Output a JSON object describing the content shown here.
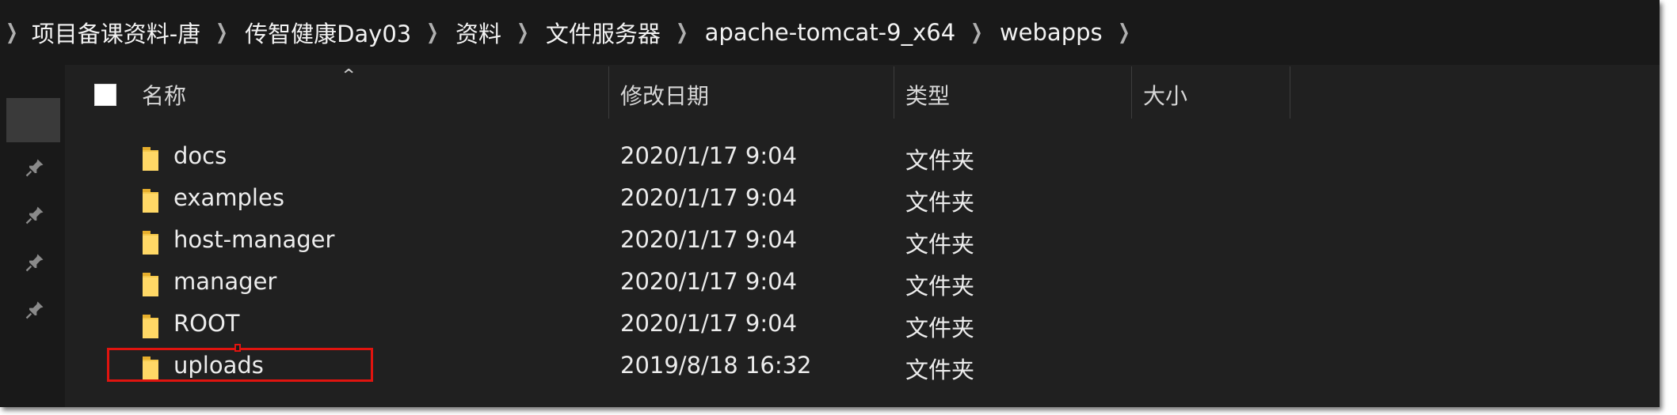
{
  "breadcrumb": {
    "items": [
      "项目备课资料-唐",
      "传智健康Day03",
      "资料",
      "文件服务器",
      "apache-tomcat-9_x64",
      "webapps"
    ]
  },
  "columns": {
    "name": "名称",
    "modified": "修改日期",
    "type": "类型",
    "size": "大小"
  },
  "rows": [
    {
      "name": "docs",
      "modified": "2020/1/17 9:04",
      "type": "文件夹",
      "size": ""
    },
    {
      "name": "examples",
      "modified": "2020/1/17 9:04",
      "type": "文件夹",
      "size": ""
    },
    {
      "name": "host-manager",
      "modified": "2020/1/17 9:04",
      "type": "文件夹",
      "size": ""
    },
    {
      "name": "manager",
      "modified": "2020/1/17 9:04",
      "type": "文件夹",
      "size": ""
    },
    {
      "name": "ROOT",
      "modified": "2020/1/17 9:04",
      "type": "文件夹",
      "size": ""
    },
    {
      "name": "uploads",
      "modified": "2019/8/18 16:32",
      "type": "文件夹",
      "size": ""
    }
  ],
  "icons": {
    "folder": "folder-icon",
    "pin": "pin-icon",
    "chevron": "chevron-right-icon",
    "sort": "sort-ascending-icon"
  },
  "colors": {
    "background": "#191919",
    "list_background": "#202020",
    "text": "#ececec",
    "folder_yellow": "#f5c84a",
    "highlight_red": "#e0140f"
  }
}
